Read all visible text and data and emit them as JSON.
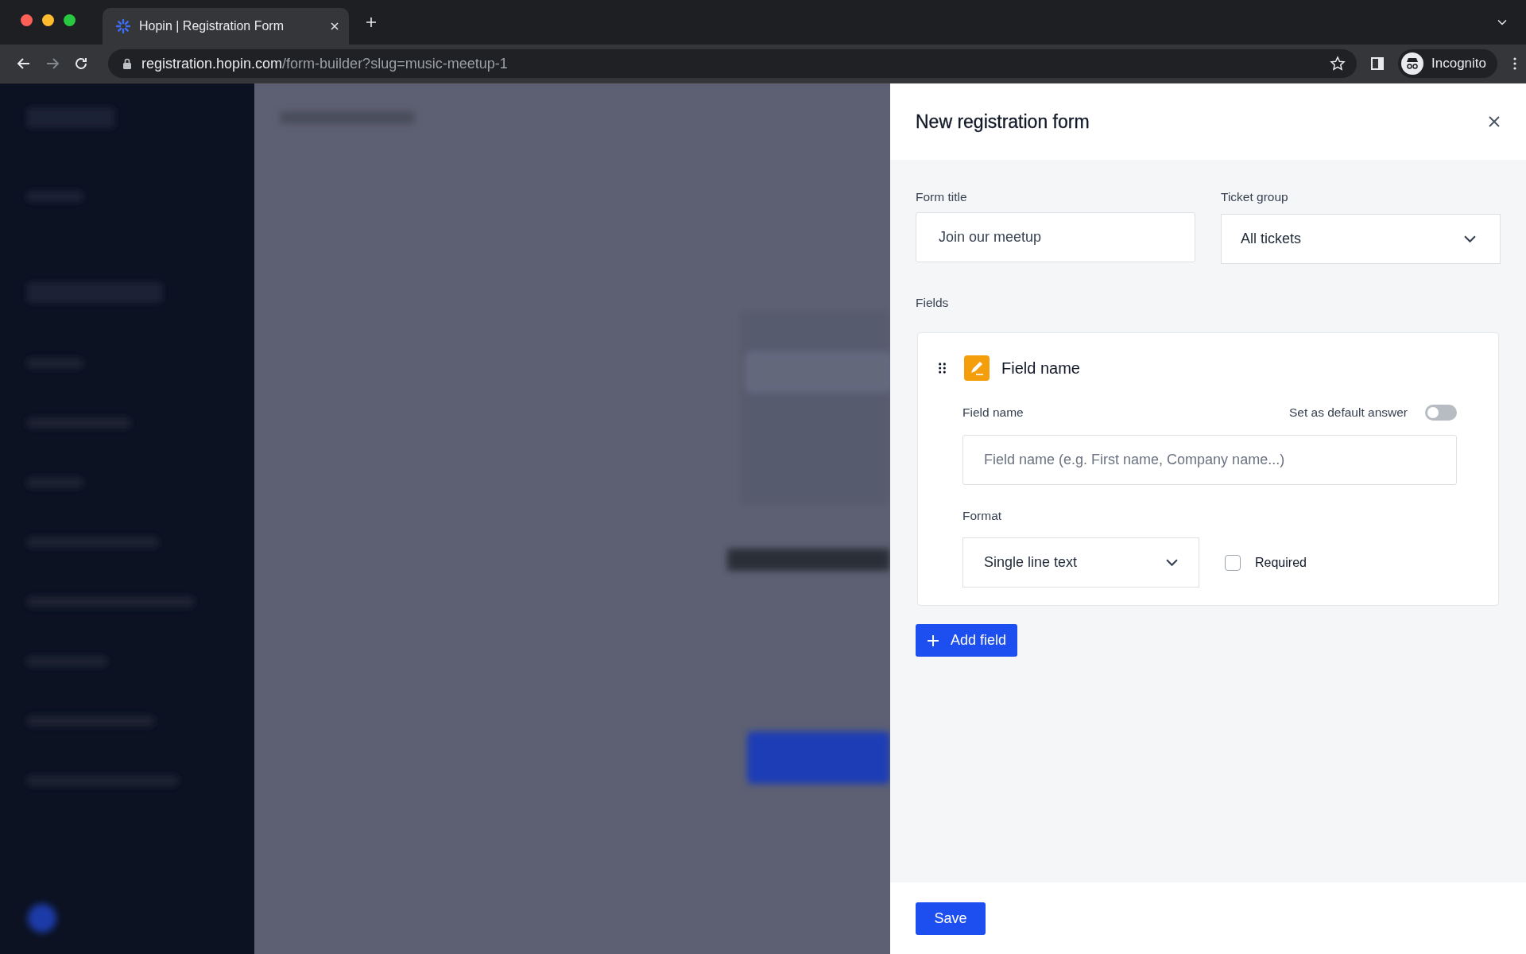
{
  "browser": {
    "tab_title": "Hopin | Registration Form",
    "url_host": "registration.hopin.com",
    "url_path": "/form-builder?slug=music-meetup-1",
    "profile_label": "Incognito"
  },
  "panel": {
    "title": "New registration form",
    "form_title": {
      "label": "Form title",
      "value": "Join our meetup"
    },
    "ticket_group": {
      "label": "Ticket group",
      "value": "All tickets"
    },
    "fields_label": "Fields",
    "fields": [
      {
        "title": "Field name",
        "name_label": "Field name",
        "default_toggle": {
          "label": "Set as default answer",
          "on": false
        },
        "name_placeholder": "Field name (e.g. First name, Company name...)",
        "format_label": "Format",
        "format_value": "Single line text",
        "required": {
          "label": "Required",
          "checked": false
        }
      }
    ],
    "add_button": "Add field",
    "save_button": "Save"
  }
}
